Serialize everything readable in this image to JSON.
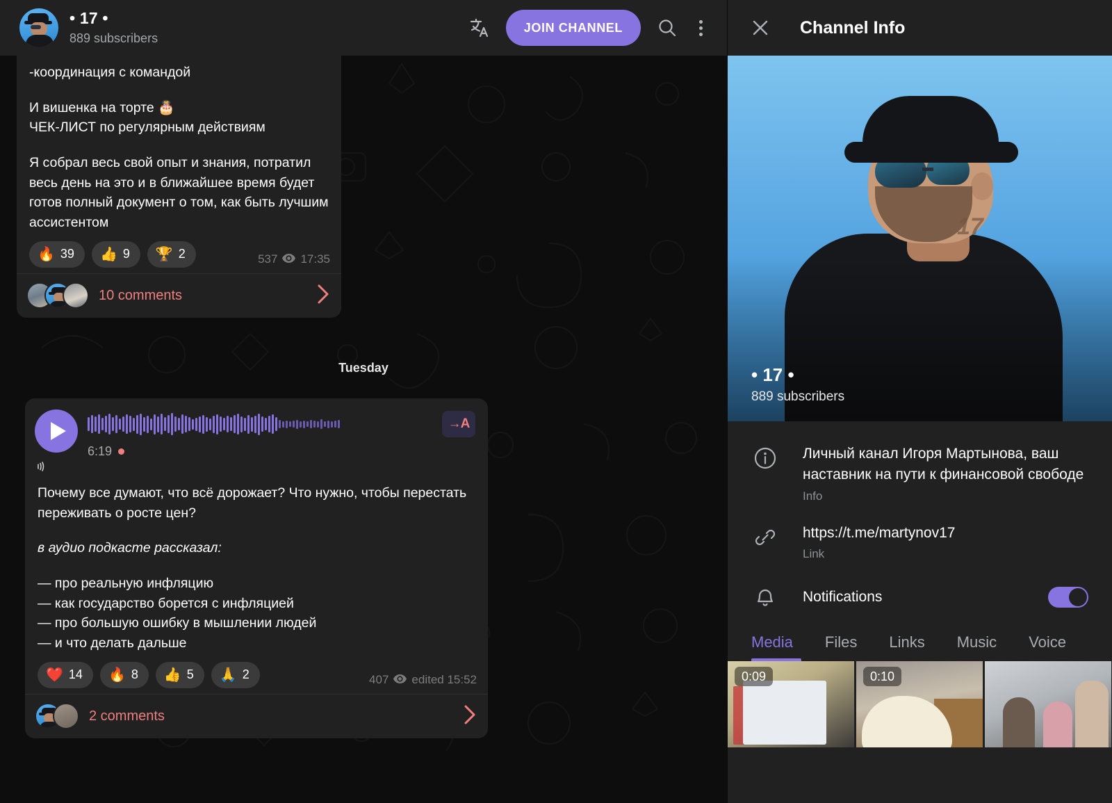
{
  "header": {
    "channel_title": "• 17 •",
    "subscribers": "889 subscribers",
    "join_label": "JOIN CHANNEL",
    "translate_icon": "translate-icon",
    "search_icon": "search-icon",
    "menu_icon": "kebab-menu-icon"
  },
  "messages": [
    {
      "text_lines": [
        "-координация с командой",
        "",
        "И вишенка на торте 🎂",
        "ЧЕК-ЛИСТ по регулярным действиям",
        "",
        "Я собрал весь свой опыт и знания, потратил весь день на это и в ближайшее время будет готов полный документ о том, как быть лучшим ассистентом"
      ],
      "part1": "-координация с командой",
      "part2": "И вишенка на торте 🎂\nЧЕК-ЛИСТ по регулярным действиям",
      "part3": "Я собрал весь свой опыт и знания, потратил весь день на это и в ближайшее время будет готов полный документ о том, как быть лучшим ассистентом",
      "reactions": [
        {
          "emoji": "🔥",
          "count": "39"
        },
        {
          "emoji": "👍",
          "count": "9"
        },
        {
          "emoji": "🏆",
          "count": "2"
        }
      ],
      "views": "537",
      "time": "17:35",
      "comments_label": "10 comments"
    },
    {
      "audio": {
        "duration": "6:19",
        "transcribe_label": "→A",
        "play_icon": "play-icon",
        "unread_dot": true
      },
      "heading": "Почему все думают, что всё дорожает? Что нужно, чтобы перестать переживать о росте цен?",
      "italic_line": "в аудио подкасте рассказал:",
      "bullets": "— про реальную инфляцию\n— как государство борется с инфляцией\n— про большую ошибку в мышлении людей\n— и что делать дальше",
      "reactions": [
        {
          "emoji": "❤️",
          "count": "14"
        },
        {
          "emoji": "🔥",
          "count": "8"
        },
        {
          "emoji": "👍",
          "count": "5"
        },
        {
          "emoji": "🙏",
          "count": "2"
        }
      ],
      "views": "407",
      "time": "edited 15:52",
      "comments_label": "2 comments"
    }
  ],
  "date_divider": "Tuesday",
  "info_panel": {
    "title": "Channel Info",
    "close_icon": "close-icon",
    "profile": {
      "name": "• 17 •",
      "subscribers": "889 subscribers",
      "tattoo": "17"
    },
    "rows": [
      {
        "icon": "info-icon",
        "value": "Личный канал Игоря Мартынова, ваш наставник на пути к финансовой свободе",
        "caption": "Info"
      },
      {
        "icon": "link-icon",
        "value": "https://t.me/martynov17",
        "caption": "Link"
      }
    ],
    "notifications": {
      "icon": "bell-icon",
      "label": "Notifications",
      "enabled": "on"
    },
    "tabs": [
      {
        "label": "Media",
        "active": true
      },
      {
        "label": "Files",
        "active": false
      },
      {
        "label": "Links",
        "active": false
      },
      {
        "label": "Music",
        "active": false
      },
      {
        "label": "Voice",
        "active": false
      }
    ],
    "media": [
      {
        "duration": "0:09"
      },
      {
        "duration": "0:10"
      },
      {
        "duration": ""
      }
    ]
  },
  "colors": {
    "accent_purple": "#8774e1",
    "comment_pink": "#f07f7f",
    "panel_bg": "#212121",
    "chat_bg": "#0d0d0d"
  }
}
